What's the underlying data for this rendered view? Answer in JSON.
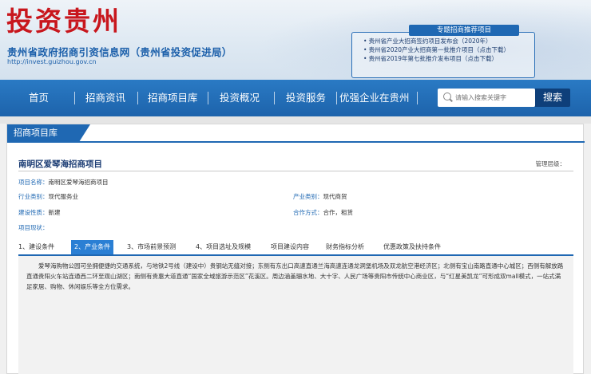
{
  "header": {
    "logo_text": "投资贵州",
    "site_name": "贵州省政府招商引资信息网（贵州省投资促进局）",
    "site_url": "http://invest.guizhou.gov.cn"
  },
  "recommend": {
    "title": "专题招商推荐项目",
    "items": [
      "贵州省产业大招商签约项目发布会（2020年）",
      "贵州省2020产业大招商第一批推介项目（点击下载）",
      "贵州省2019年第七批推介发布项目（点击下载）"
    ]
  },
  "nav": {
    "items": [
      "首页",
      "招商资讯",
      "招商项目库",
      "投资概况",
      "投资服务",
      "优强企业在贵州"
    ],
    "search_placeholder": "请输入搜索关键字",
    "search_button": "搜索"
  },
  "panel": {
    "tab_label": "招商项目库",
    "project_title": "南明区爱琴海招商项目",
    "level_label": "管理层级：",
    "fields": {
      "name_label": "项目名称：",
      "name_value": "南明区爱琴海招商项目",
      "industry_label": "行业类别：",
      "industry_value": "现代服务业",
      "product_label": "产业类别：",
      "product_value": "现代商贸",
      "nature_label": "建设性质：",
      "nature_value": "新建",
      "coop_label": "合作方式：",
      "coop_value": "合作，租赁",
      "status_label": "项目现状：",
      "status_value": ""
    },
    "tabs": [
      "1、建设条件",
      "2、产业条件",
      "3、市场前景预测",
      "4、项目选址及规模",
      "项目建设内容",
      "财务指标分析",
      "优惠政策及扶持条件"
    ],
    "active_tab": "2、产业条件",
    "content_text": "爱琴海购物公园可坐拥便捷的交通系统，与地铁2号线（建设中）贵钢站无缝对接；东侧有东出口高速直通兰海高速连通龙洞堡机场及双龙航空港经济区；北侧有宝山南路直通中心城区；西侧有解放路直通贵阳火车站连通西二环至观山湖区；南侧有贵惠大道直通“国家全域旅游示范区”花溪区。周边涵盖珊水地、大十字、人民广场等贵阳市传统中心商业区，与“红星美凯龙”可形成双mall模式，一站式满足家居、购物、休闲娱乐等全方位需求。"
  },
  "colors": {
    "brand_blue": "#1f68b3",
    "logo_red": "#c8161d",
    "search_button": "#0e3f7a"
  }
}
